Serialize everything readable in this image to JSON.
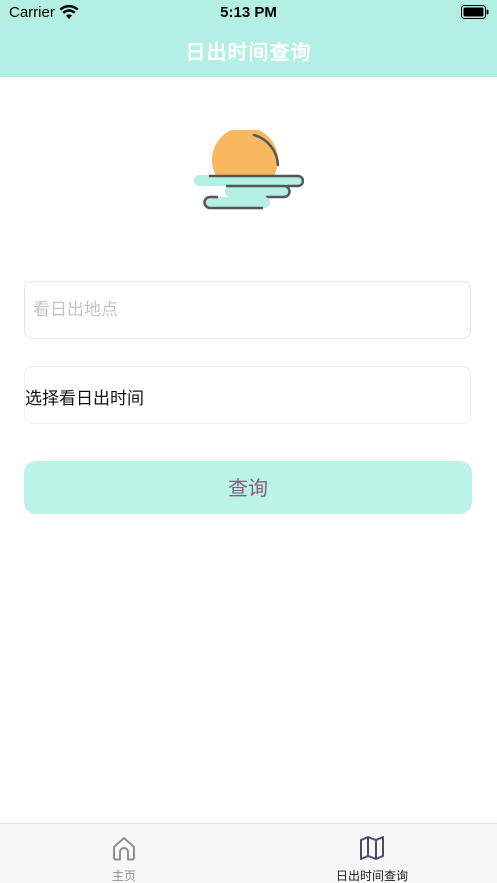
{
  "status_bar": {
    "carrier": "Carrier",
    "time": "5:13 PM"
  },
  "nav": {
    "title": "日出时间查询"
  },
  "form": {
    "location_placeholder": "看日出地点",
    "location_value": "",
    "time_label": "选择看日出时间",
    "query_label": "查询"
  },
  "tabs": [
    {
      "label": "主页",
      "icon": "home-icon",
      "active": false
    },
    {
      "label": "日出时间查询",
      "icon": "map-icon",
      "active": true
    }
  ],
  "colors": {
    "header_bg": "#b3f0e3",
    "button_bg": "#bbf4e7",
    "button_text": "#8a5a78",
    "sun": "#f9b860",
    "cloud": "#b3f0e3",
    "tab_active": "#1a1a1a",
    "tab_inactive": "#8e8e8e"
  }
}
